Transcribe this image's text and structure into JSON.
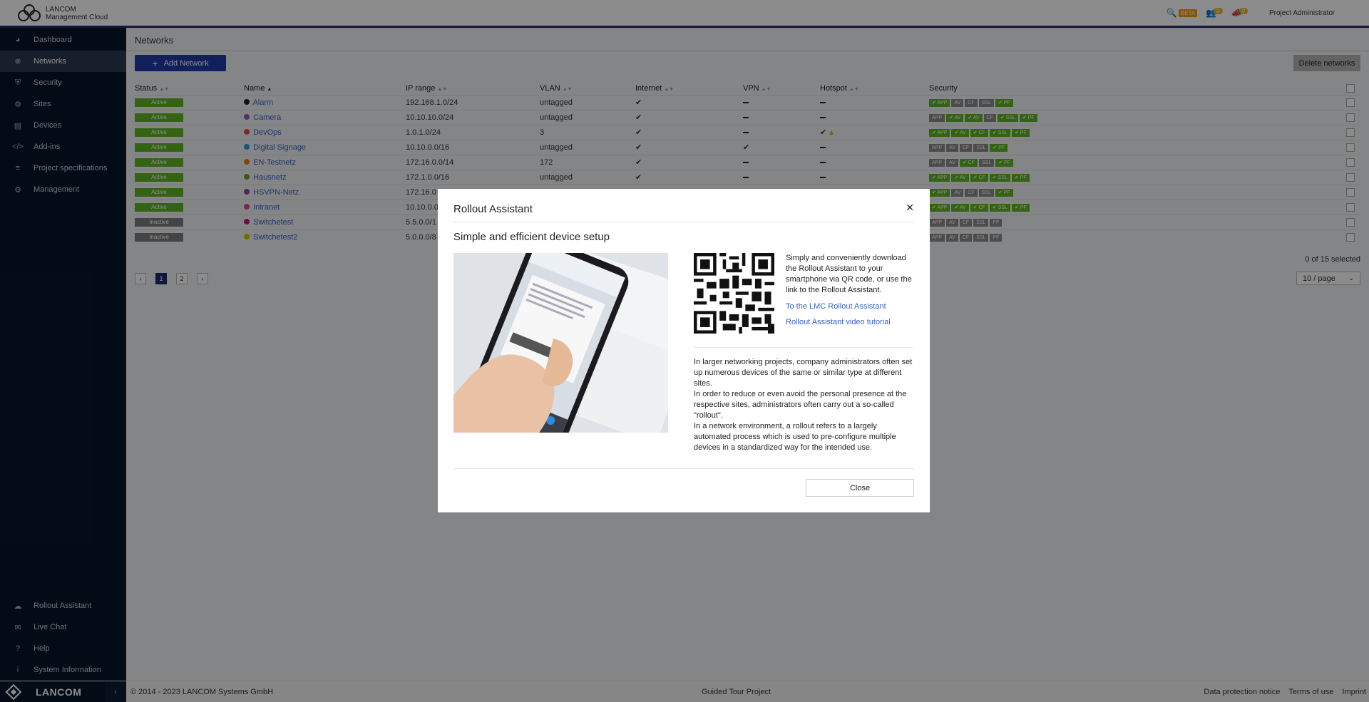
{
  "header": {
    "brand_line1": "LANCOM",
    "brand_line2": "Management Cloud",
    "beta": "BETA",
    "notif_count1": "0",
    "notif_count2": "0",
    "user": "Project Administrator"
  },
  "sidebar": {
    "items": [
      {
        "label": "Dashboard",
        "icon": "dashboard-icon"
      },
      {
        "label": "Networks",
        "icon": "networks-icon"
      },
      {
        "label": "Security",
        "icon": "shield-icon"
      },
      {
        "label": "Sites",
        "icon": "sites-icon"
      },
      {
        "label": "Devices",
        "icon": "devices-icon"
      },
      {
        "label": "Add-ins",
        "icon": "code-icon"
      },
      {
        "label": "Project specifications",
        "icon": "sliders-icon"
      },
      {
        "label": "Management",
        "icon": "gear-icon"
      }
    ],
    "bottom_items": [
      {
        "label": "Rollout Assistant",
        "icon": "cloud-icon"
      },
      {
        "label": "Live Chat",
        "icon": "chat-icon"
      },
      {
        "label": "Help",
        "icon": "help-icon"
      },
      {
        "label": "System Information",
        "icon": "info-icon"
      }
    ]
  },
  "main": {
    "title": "Networks",
    "add_button": "Add Network",
    "delete_button": "Delete networks",
    "columns": [
      "Status",
      "Name",
      "IP range",
      "VLAN",
      "Internet",
      "VPN",
      "Hotspot",
      "Security"
    ],
    "rows": [
      {
        "status": "Active",
        "state": "active",
        "dot": "#222222",
        "name": "Alarm",
        "ip": "192.168.1.0/24",
        "vlan": "untagged",
        "internet": true,
        "vpn": false,
        "hotspot": false,
        "hotspot_warn": false,
        "tags": [
          [
            "APP",
            true
          ],
          [
            "AV",
            false
          ],
          [
            "CF",
            false
          ],
          [
            "SSL",
            false
          ],
          [
            "PF",
            true
          ]
        ]
      },
      {
        "status": "Active",
        "state": "active",
        "dot": "#9b59b6",
        "name": "Camera",
        "ip": "10.10.10.0/24",
        "vlan": "untagged",
        "internet": true,
        "vpn": false,
        "hotspot": false,
        "hotspot_warn": false,
        "tags": [
          [
            "APP",
            false
          ],
          [
            "AV",
            true
          ],
          [
            "AV",
            true
          ],
          [
            "CF",
            false
          ],
          [
            "SSL",
            true
          ],
          [
            "PF",
            true
          ]
        ]
      },
      {
        "status": "Active",
        "state": "active",
        "dot": "#e74c3c",
        "name": "DevOps",
        "ip": "1.0.1.0/24",
        "vlan": "3",
        "internet": true,
        "vpn": false,
        "hotspot": true,
        "hotspot_warn": true,
        "tags": [
          [
            "APP",
            true
          ],
          [
            "AV",
            true
          ],
          [
            "CF",
            true
          ],
          [
            "SSL",
            true
          ],
          [
            "PF",
            true
          ]
        ]
      },
      {
        "status": "Active",
        "state": "active",
        "dot": "#3498db",
        "name": "Digital Signage",
        "ip": "10.10.0.0/16",
        "vlan": "untagged",
        "internet": true,
        "vpn": true,
        "hotspot": false,
        "hotspot_warn": false,
        "tags": [
          [
            "APP",
            false
          ],
          [
            "AV",
            false
          ],
          [
            "CF",
            false
          ],
          [
            "SSL",
            false
          ],
          [
            "PF",
            true
          ]
        ]
      },
      {
        "status": "Active",
        "state": "active",
        "dot": "#e67e22",
        "name": "EN-Testnetz",
        "ip": "172.16.0.0/14",
        "vlan": "172",
        "internet": true,
        "vpn": false,
        "hotspot": false,
        "hotspot_warn": false,
        "tags": [
          [
            "APP",
            false
          ],
          [
            "AV",
            false
          ],
          [
            "CF",
            true
          ],
          [
            "SSL",
            false
          ],
          [
            "PF",
            true
          ]
        ]
      },
      {
        "status": "Active",
        "state": "active",
        "dot": "#7a9a2a",
        "name": "Hausnetz",
        "ip": "172.1.0.0/16",
        "vlan": "untagged",
        "internet": true,
        "vpn": false,
        "hotspot": false,
        "hotspot_warn": false,
        "tags": [
          [
            "APP",
            true
          ],
          [
            "AV",
            true
          ],
          [
            "CF",
            true
          ],
          [
            "SSL",
            true
          ],
          [
            "PF",
            true
          ]
        ]
      },
      {
        "status": "Active",
        "state": "active",
        "dot": "#8e44ad",
        "name": "HSVPN-Netz",
        "ip": "172.16.0",
        "vlan": "",
        "internet": false,
        "vpn": false,
        "hotspot": false,
        "hotspot_warn": false,
        "tags": [
          [
            "APP",
            true
          ],
          [
            "AV",
            false
          ],
          [
            "CF",
            false
          ],
          [
            "SSL",
            false
          ],
          [
            "PF",
            true
          ]
        ]
      },
      {
        "status": "Active",
        "state": "active",
        "dot": "#e84393",
        "name": "Intranet",
        "ip": "10.10.0.0",
        "vlan": "",
        "internet": false,
        "vpn": false,
        "hotspot": false,
        "hotspot_warn": false,
        "tags": [
          [
            "APP",
            true
          ],
          [
            "AV",
            true
          ],
          [
            "CF",
            true
          ],
          [
            "SSL",
            true
          ],
          [
            "PF",
            true
          ]
        ]
      },
      {
        "status": "Inactive",
        "state": "inactive",
        "dot": "#c71585",
        "name": "Switchetest",
        "ip": "5.5.0.0/1",
        "vlan": "",
        "internet": false,
        "vpn": false,
        "hotspot": false,
        "hotspot_warn": false,
        "tags": [
          [
            "APP",
            false
          ],
          [
            "AV",
            false
          ],
          [
            "CF",
            false
          ],
          [
            "SSL",
            false
          ],
          [
            "PF",
            false
          ]
        ]
      },
      {
        "status": "Inactive",
        "state": "inactive",
        "dot": "#c8c800",
        "name": "Switchetest2",
        "ip": "5.0.0.0/8",
        "vlan": "",
        "internet": false,
        "vpn": false,
        "hotspot": false,
        "hotspot_warn": false,
        "tags": [
          [
            "APP",
            false
          ],
          [
            "AV",
            false
          ],
          [
            "CF",
            false
          ],
          [
            "SSL",
            false
          ],
          [
            "PF",
            false
          ]
        ]
      }
    ],
    "selected_count": "0 of 15 selected",
    "pages": [
      "1",
      "2"
    ],
    "per_page": "10 / page"
  },
  "footer": {
    "brand": "LANCOM",
    "copyright": "© 2014 - 2023 LANCOM Systems GmbH",
    "center": "Guided Tour Project",
    "links": [
      "Data protection notice",
      "Terms of use",
      "Imprint"
    ]
  },
  "modal": {
    "title": "Rollout Assistant",
    "subtitle": "Simple and efficient device setup",
    "qr_text": "Simply and conveniently download the Rollout Assistant to your smartphone via QR code, or use the link to the Rollout Assistant.",
    "link1": "To the LMC Rollout Assistant",
    "link2": "Rollout Assistant video tutorial",
    "paragraphs": [
      "In larger networking projects, company administrators often set up numerous devices of the same or similar type at different sites.",
      "In order to reduce or even avoid the personal presence at the respective sites, administrators often carry out a so-called \"rollout\".",
      "In a network environment, a rollout refers to a largely automated process which is used to pre-configure multiple devices in a standardized way for the intended use."
    ],
    "close_button": "Close"
  }
}
